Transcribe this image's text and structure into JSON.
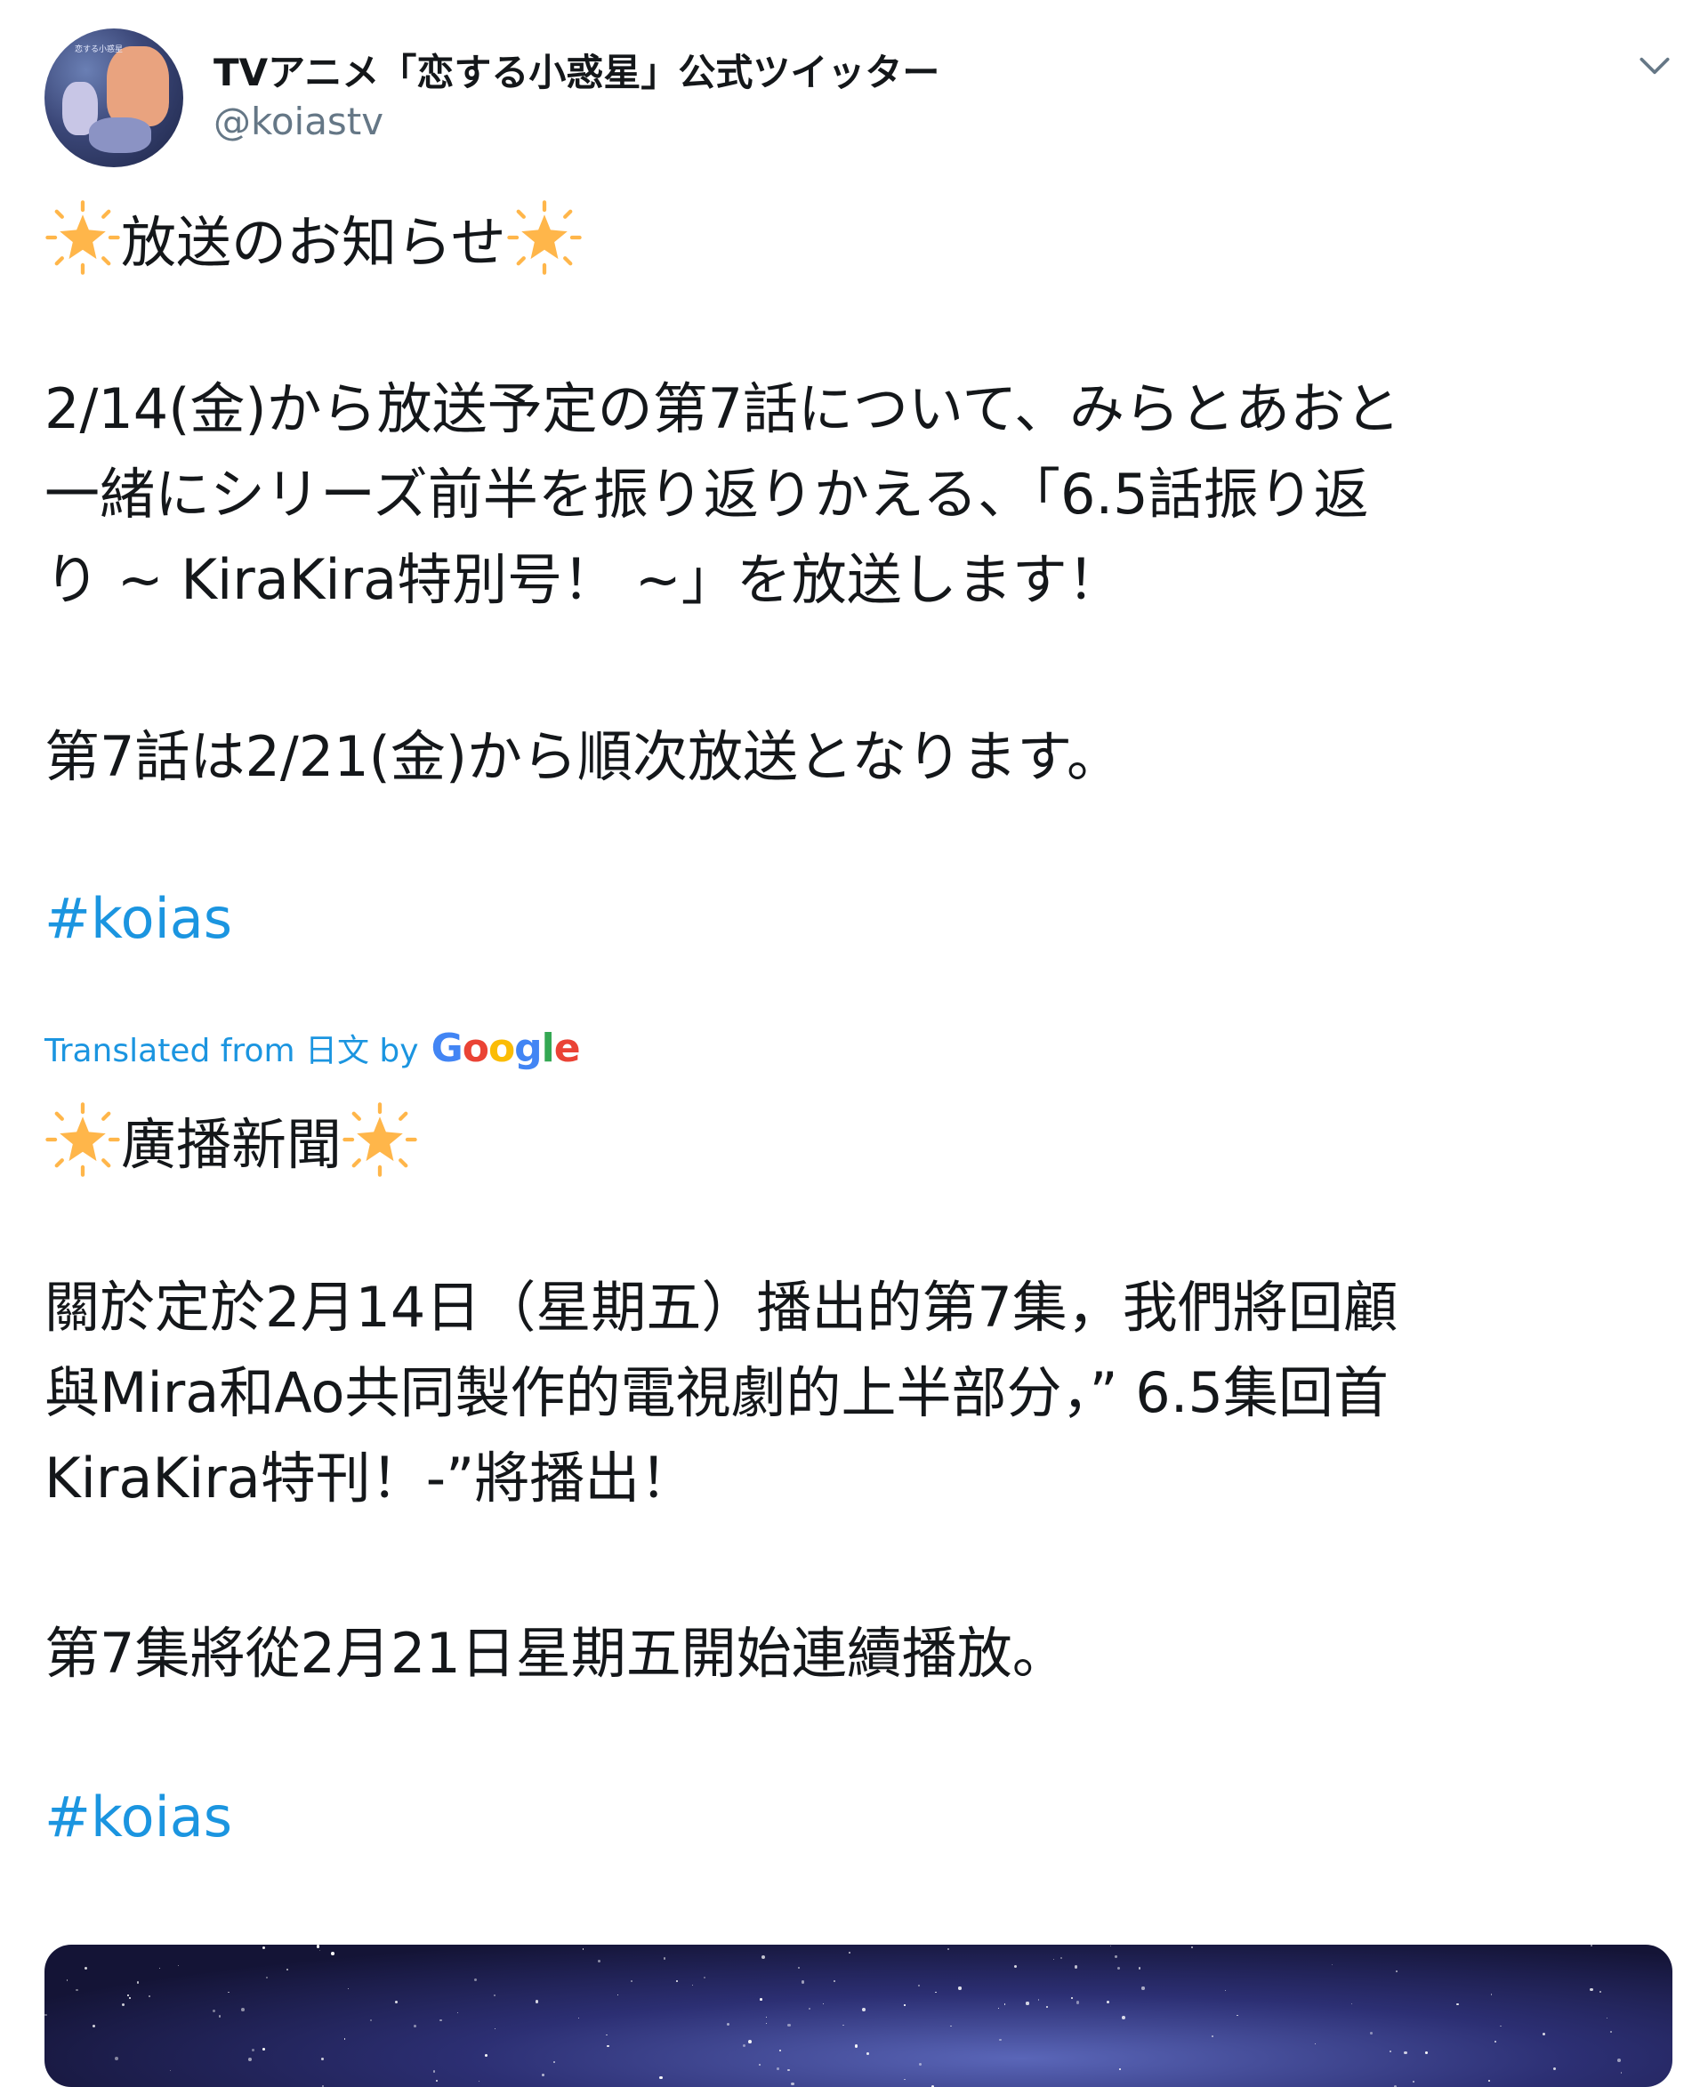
{
  "tweet": {
    "author_name": "TVアニメ「恋する小惑星」公式ツイッター",
    "handle": "@koiastv",
    "avatar_text": "恋する小惑星",
    "original": {
      "title": "放送のお知らせ",
      "para1": "2/14(金)から放送予定の第7話について、みらとあおと\n一緒にシリーズ前半を振り返りかえる、「6.5話振り返\nり ~ KiraKira特別号！ ~」を放送します！",
      "para2": "第7話は2/21(金)から順次放送となります。",
      "hashtag": "#koias"
    },
    "translation_label": "Translated from 日文 by",
    "translation_provider": [
      "G",
      "o",
      "o",
      "g",
      "l",
      "e"
    ],
    "translated": {
      "title": "廣播新聞",
      "para1": "關於定於2月14日（星期五）播出的第7集，我們將回顧\n與Mira和Ao共同製作的電視劇的上半部分，” 6.5集回首\nKiraKira特刊！-”將播出！",
      "para2": "第7集將從2月21日星期五開始連續播放。",
      "hashtag": "#koias"
    }
  },
  "colors": {
    "link": "#1b95e0",
    "secondary_text": "#657786",
    "star": "#ffb64a"
  },
  "icons": {
    "caret": "chevron-down-icon",
    "title_emoji": "glowing-star-icon"
  }
}
